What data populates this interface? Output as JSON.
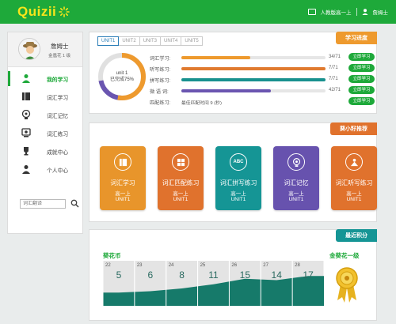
{
  "app": {
    "logo": "Quizii",
    "colors": {
      "primary": "#1ea93a",
      "logo": "#f7e51b",
      "orange": "#ee9a2e"
    }
  },
  "topbar": {
    "textbook": "人教版高一上",
    "user": "詹姆士"
  },
  "sidebar": {
    "profile": {
      "name": "詹姆士",
      "class": "金凰花 1 级"
    },
    "nav": [
      {
        "label": "我的学习",
        "icon": "user-study-icon",
        "active": true
      },
      {
        "label": "词汇学习",
        "icon": "book-icon",
        "active": false
      },
      {
        "label": "词汇记忆",
        "icon": "brain-icon",
        "active": false
      },
      {
        "label": "词汇练习",
        "icon": "practice-icon",
        "active": false
      },
      {
        "label": "成就中心",
        "icon": "trophy-icon",
        "active": false
      },
      {
        "label": "个人中心",
        "icon": "person-icon",
        "active": false
      }
    ],
    "search": {
      "placeholder": "词汇翻译"
    }
  },
  "progress": {
    "tag": "学习进度",
    "units": [
      "UNIT1",
      "UNIT2",
      "UNIT3",
      "UNIT4",
      "UNIT5"
    ],
    "donut": {
      "unit": "unit 1",
      "completed": "已完成75%",
      "percent": 75
    },
    "rows": [
      {
        "label": "词汇学习:",
        "count": "34/71",
        "button": "立即学习",
        "fraction": 0.48,
        "color": "#ee9a2e"
      },
      {
        "label": "听写练习:",
        "count": "7/71",
        "button": "立即学习",
        "fraction": 1.0,
        "color": "#e07a2f"
      },
      {
        "label": "拼写练习:",
        "count": "7/71",
        "button": "立即学习",
        "fraction": 1.0,
        "color": "#18918f"
      },
      {
        "label": "微 语 词:",
        "count": "42/71",
        "button": "立即学习",
        "fraction": 0.62,
        "color": "#6a55b0"
      },
      {
        "label": "匹配练习:",
        "best": "最佳匹配时间 9 (秒)",
        "button": "立即学习"
      }
    ]
  },
  "recommend": {
    "tag": "葵小籽推荐",
    "cards": [
      {
        "title": "词汇学习",
        "grade": "高一上",
        "unit": "UNIT1",
        "color": "#e8952b",
        "icon": "book-icon",
        "icon_text": ""
      },
      {
        "title": "词汇匹配练习",
        "grade": "高一上",
        "unit": "UNIT1",
        "color": "#e0722d",
        "icon": "grid-icon",
        "icon_text": ""
      },
      {
        "title": "词汇拼写练习",
        "grade": "高一上",
        "unit": "UNIT1",
        "color": "#159595",
        "icon": "abc-icon",
        "icon_text": "ABC"
      },
      {
        "title": "词汇记忆",
        "grade": "高一上",
        "unit": "UNIT1",
        "color": "#6752ae",
        "icon": "brain-icon",
        "icon_text": ""
      },
      {
        "title": "词汇听写练习",
        "grade": "高一上",
        "unit": "UNIT1",
        "color": "#e0722d",
        "icon": "listen-icon",
        "icon_text": ""
      }
    ]
  },
  "points": {
    "tag": "最近积分",
    "coin_title": "葵花币",
    "level_title": "金葵花一级",
    "chart_data": {
      "type": "area",
      "x": [
        "22",
        "23",
        "24",
        "25",
        "26",
        "27",
        "28"
      ],
      "values": [
        5,
        6,
        8,
        11,
        15,
        14,
        17
      ],
      "title": "葵花币",
      "fill": "#167a6a"
    }
  }
}
